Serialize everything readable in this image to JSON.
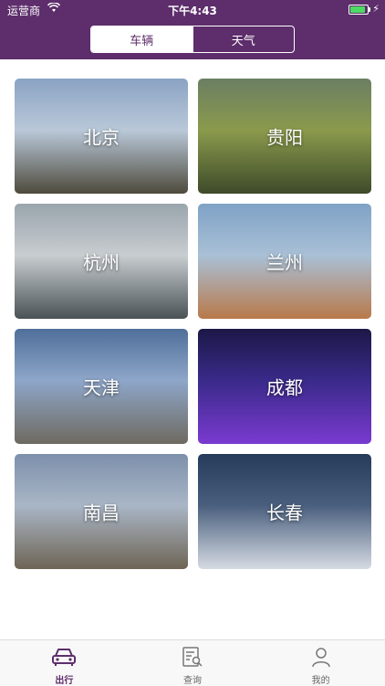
{
  "status_bar": {
    "carrier": "运营商",
    "time": "下午4:43",
    "battery_level": 0.9
  },
  "segmented_control": {
    "tabs": [
      {
        "label": "车辆",
        "selected": true
      },
      {
        "label": "天气",
        "selected": false
      }
    ]
  },
  "cities": [
    {
      "name": "北京",
      "colors": [
        "#8aa3c3",
        "#b9c8d8",
        "#4e4a3c"
      ]
    },
    {
      "name": "贵阳",
      "colors": [
        "#6b7f63",
        "#8a9a4c",
        "#3e4a2a"
      ]
    },
    {
      "name": "杭州",
      "colors": [
        "#9aa5ad",
        "#c8cdd0",
        "#4a5255"
      ]
    },
    {
      "name": "兰州",
      "colors": [
        "#7fa2c6",
        "#a9c0d6",
        "#b9794a"
      ]
    },
    {
      "name": "天津",
      "colors": [
        "#4f6f9a",
        "#8ea6c9",
        "#6e6a60"
      ]
    },
    {
      "name": "成都",
      "colors": [
        "#1b1846",
        "#3a2a8a",
        "#7a3ad0"
      ]
    },
    {
      "name": "南昌",
      "colors": [
        "#7d90ab",
        "#a9b6c6",
        "#6e6455"
      ]
    },
    {
      "name": "长春",
      "colors": [
        "#263a5a",
        "#4a5f7e",
        "#d6dbe3"
      ]
    }
  ],
  "tab_bar": {
    "items": [
      {
        "label": "出行",
        "icon": "car-icon",
        "active": true
      },
      {
        "label": "查询",
        "icon": "search-document-icon",
        "active": false
      },
      {
        "label": "我的",
        "icon": "user-icon",
        "active": false
      }
    ],
    "active_color": "#5d2e6b"
  },
  "colors": {
    "brand": "#5d2e6b"
  }
}
